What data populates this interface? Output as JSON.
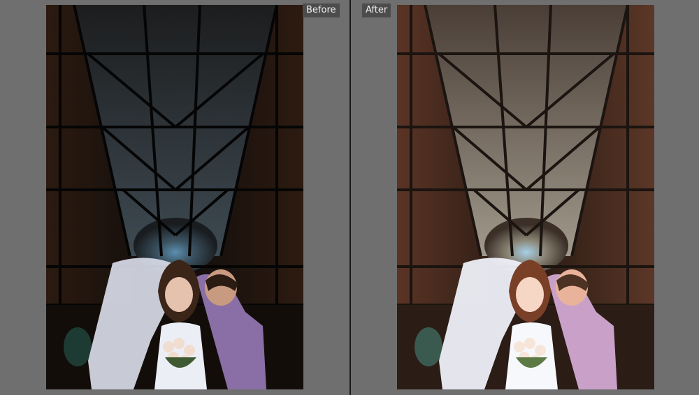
{
  "comparison": {
    "before_label": "Before",
    "after_label": "After"
  },
  "colors": {
    "background": "#6f6f6f",
    "divider": "#1a1a1a",
    "label_bg": "#4c4c4c",
    "label_text": "#f0f0f0"
  },
  "photo": {
    "subject": "wedding-couple-under-steel-roof",
    "variants": [
      "before-dark-cool",
      "after-warm-bright"
    ]
  }
}
